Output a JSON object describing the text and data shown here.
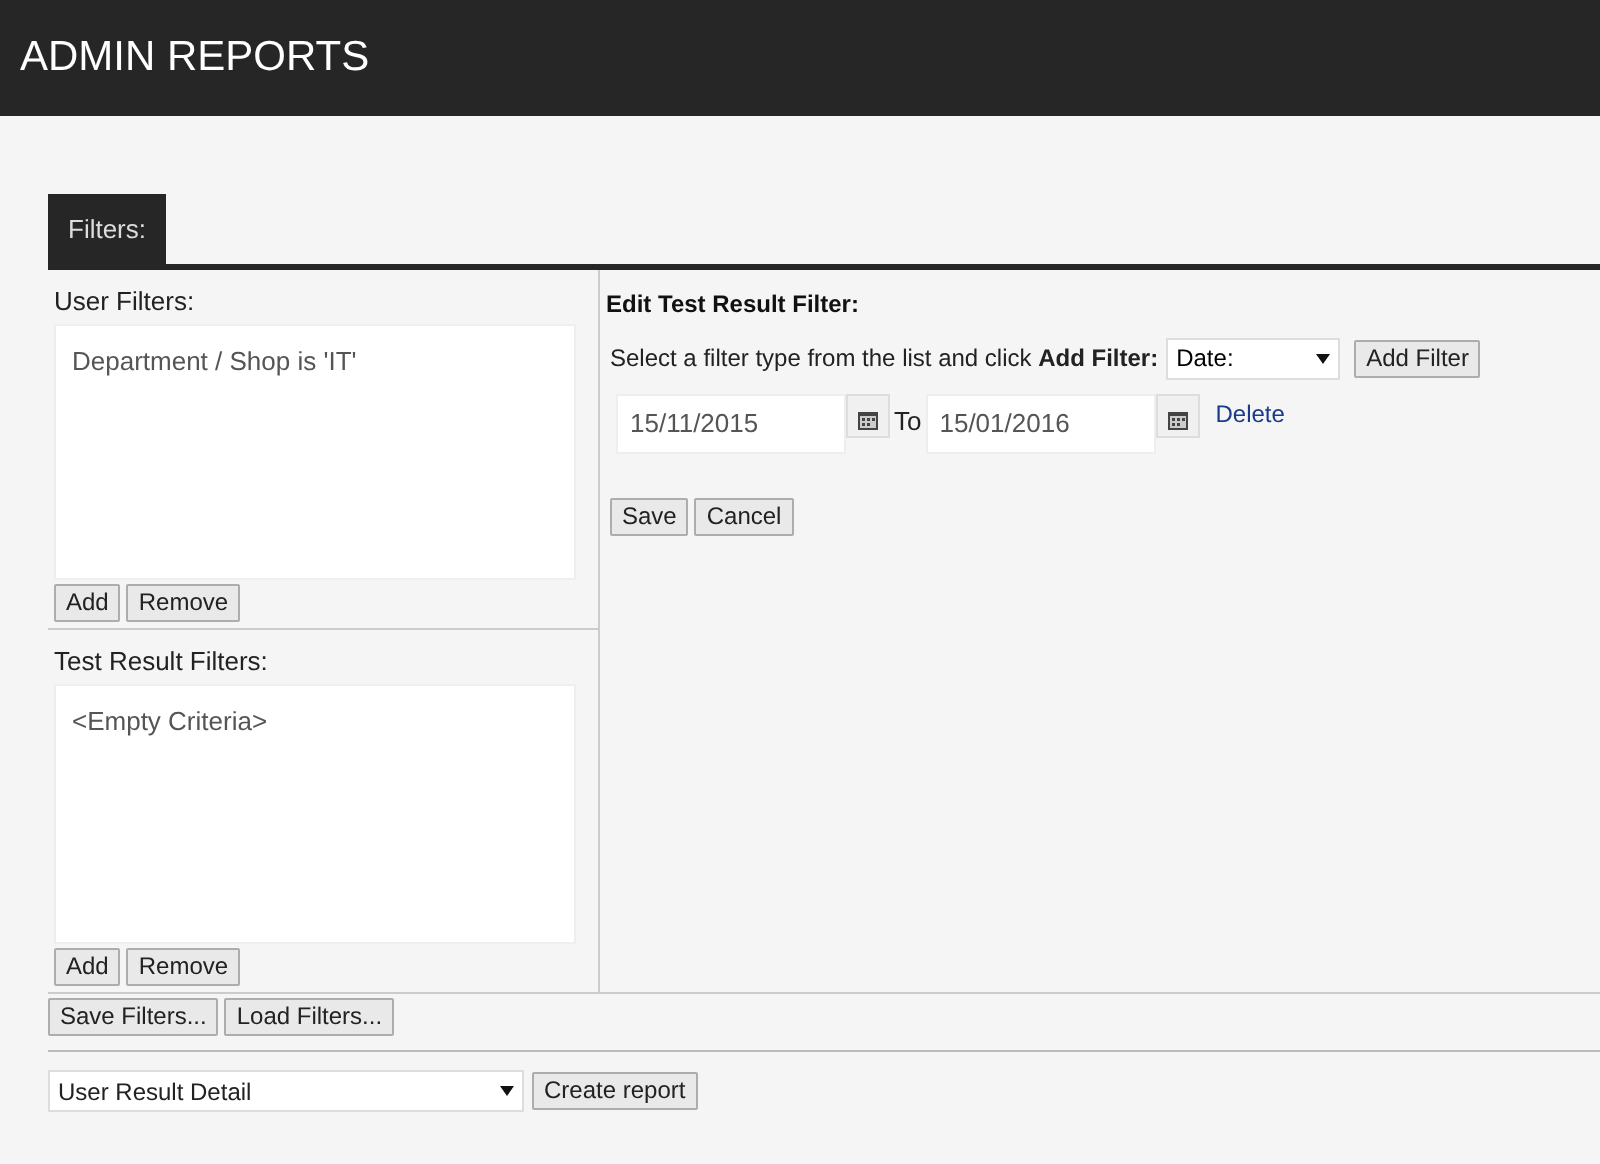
{
  "header": {
    "title": "ADMIN REPORTS"
  },
  "tabs": [
    {
      "label": "Filters:",
      "selected": true
    }
  ],
  "user_filters": {
    "label": "User Filters:",
    "items": [
      "Department / Shop is 'IT'"
    ],
    "buttons": [
      "Add",
      "Remove"
    ]
  },
  "test_result_filters": {
    "label": "Test Result Filters:",
    "items": [
      "<Empty Criteria>"
    ],
    "buttons": [
      "Add",
      "Remove"
    ]
  },
  "edit_filter": {
    "title": "Edit Test Result Filter:",
    "instruction": "Select a filter type from the list and click **Add Filter:**",
    "filter_type": "Date:",
    "add_button": "Add Filter",
    "from_date": "15/11/2015",
    "to_label": "To",
    "to_date": "15/01/2016",
    "delete_link": "Delete",
    "buttons": [
      "Save",
      "Cancel"
    ]
  },
  "filter_buttons": [
    "Save Filters...",
    "Load Filters..."
  ],
  "report": {
    "type": "User Result Detail",
    "button": "Create report"
  }
}
